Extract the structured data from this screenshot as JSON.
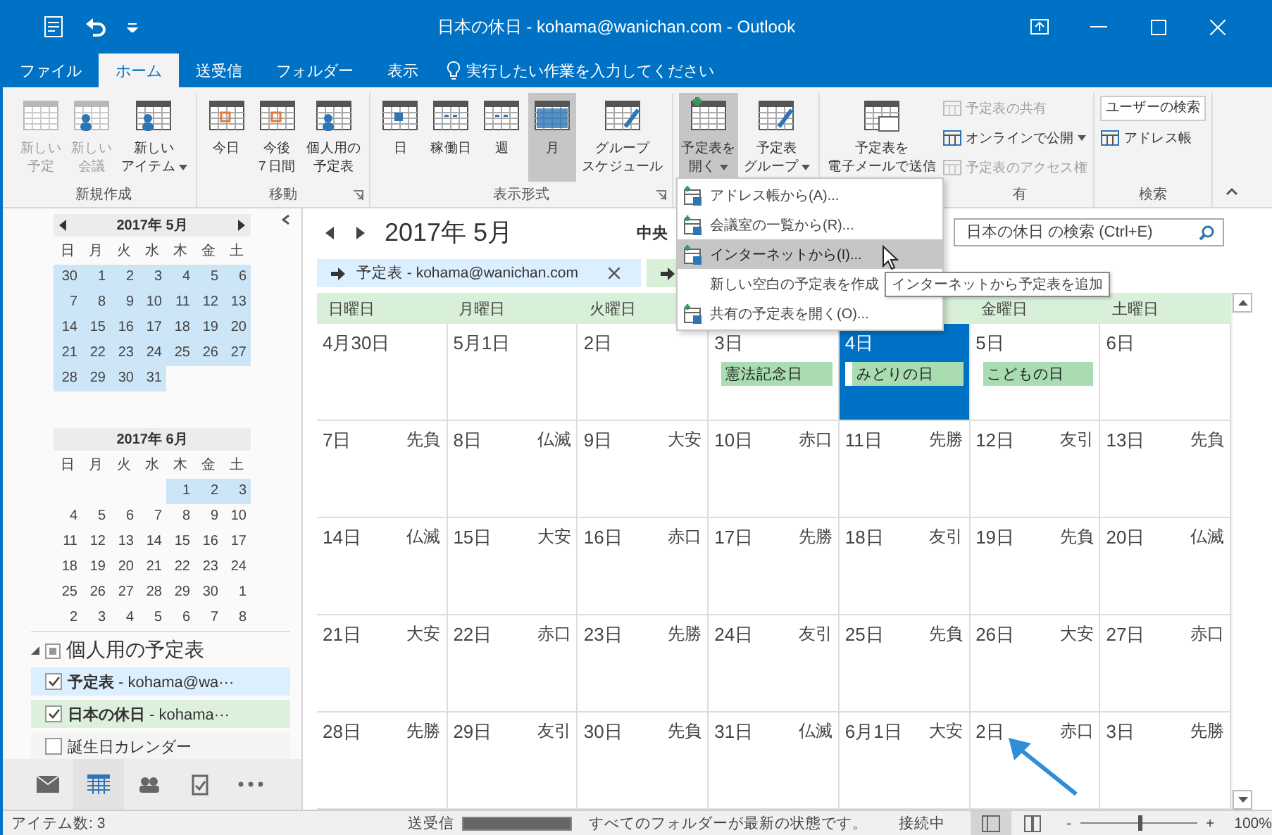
{
  "title_bar": {
    "title": "日本の休日 - kohama@wanichan.com - Outlook"
  },
  "ribbon_tabs": [
    {
      "label": "ファイル",
      "selected": false
    },
    {
      "label": "ホーム",
      "selected": true
    },
    {
      "label": "送受信",
      "selected": false
    },
    {
      "label": "フォルダー",
      "selected": false
    },
    {
      "label": "表示",
      "selected": false
    }
  ],
  "tell_me": "実行したい作業を入力してください",
  "ribbon_groups": [
    {
      "label": "新規作成",
      "launcher": false,
      "buttons": [
        {
          "kind": "large",
          "lines": [
            "新しい",
            "予定"
          ],
          "disabled": true,
          "selected": false,
          "dropdown": false
        },
        {
          "kind": "large",
          "lines": [
            "新しい",
            "会議"
          ],
          "disabled": true,
          "selected": false,
          "dropdown": false
        },
        {
          "kind": "large",
          "lines": [
            "新しい",
            "アイテム"
          ],
          "disabled": false,
          "selected": false,
          "dropdown": true
        }
      ]
    },
    {
      "label": "移動",
      "launcher": true,
      "buttons": [
        {
          "kind": "large",
          "lines": [
            "今日"
          ],
          "disabled": false,
          "selected": false,
          "dropdown": false
        },
        {
          "kind": "large",
          "lines": [
            "今後",
            "7 日間"
          ],
          "disabled": false,
          "selected": false,
          "dropdown": false
        },
        {
          "kind": "large",
          "lines": [
            "個人用の",
            "予定表"
          ],
          "disabled": false,
          "selected": false,
          "dropdown": false
        }
      ]
    },
    {
      "label": "表示形式",
      "launcher": true,
      "buttons": [
        {
          "kind": "large",
          "lines": [
            "日"
          ],
          "disabled": false,
          "selected": false,
          "dropdown": false
        },
        {
          "kind": "large",
          "lines": [
            "稼働日"
          ],
          "disabled": false,
          "selected": false,
          "dropdown": false
        },
        {
          "kind": "large",
          "lines": [
            "週"
          ],
          "disabled": false,
          "selected": false,
          "dropdown": false
        },
        {
          "kind": "large",
          "lines": [
            "月"
          ],
          "disabled": false,
          "selected": true,
          "dropdown": false
        },
        {
          "kind": "large",
          "lines": [
            "グループ",
            "スケジュール"
          ],
          "disabled": false,
          "selected": false,
          "dropdown": false
        }
      ]
    },
    {
      "buttons": [
        {
          "kind": "large",
          "lines": [
            "予定表を",
            "開く"
          ],
          "disabled": false,
          "selected": true,
          "dropdown": true
        },
        {
          "kind": "large",
          "lines": [
            "予定表",
            "グループ"
          ],
          "disabled": false,
          "selected": false,
          "dropdown": true
        }
      ]
    },
    {
      "label": "有",
      "launcher": false,
      "buttons": [
        {
          "kind": "large",
          "lines": [
            "予定表を",
            "電子メールで送信"
          ],
          "disabled": false,
          "selected": false,
          "dropdown": false
        },
        {
          "kind": "small",
          "lines": [
            "予定表の共有"
          ],
          "disabled": true,
          "dropdown": false
        },
        {
          "kind": "small",
          "lines": [
            "オンラインで公開"
          ],
          "disabled": false,
          "dropdown": true
        },
        {
          "kind": "small",
          "lines": [
            "予定表のアクセス権"
          ],
          "disabled": true,
          "dropdown": false
        }
      ]
    },
    {
      "label": "検索",
      "launcher": false,
      "buttons": [
        {
          "kind": "field",
          "lines": [
            "ユーザーの検索"
          ]
        },
        {
          "kind": "small",
          "lines": [
            "アドレス帳"
          ],
          "disabled": false,
          "dropdown": false
        }
      ]
    }
  ],
  "mini_calendars": [
    {
      "title": "2017年 5月",
      "arrows": true,
      "weekdays": [
        "日",
        "月",
        "火",
        "水",
        "木",
        "金",
        "土"
      ],
      "days": [
        {
          "day": "30",
          "highlighted": true
        },
        {
          "day": "1",
          "highlighted": true
        },
        {
          "day": "2",
          "highlighted": true
        },
        {
          "day": "3",
          "highlighted": true
        },
        {
          "day": "4",
          "highlighted": true
        },
        {
          "day": "5",
          "highlighted": true
        },
        {
          "day": "6",
          "highlighted": true
        },
        {
          "day": "7",
          "highlighted": true
        },
        {
          "day": "8",
          "highlighted": true
        },
        {
          "day": "9",
          "highlighted": true
        },
        {
          "day": "10",
          "highlighted": true
        },
        {
          "day": "11",
          "highlighted": true
        },
        {
          "day": "12",
          "highlighted": true
        },
        {
          "day": "13",
          "highlighted": true
        },
        {
          "day": "14",
          "highlighted": true
        },
        {
          "day": "15",
          "highlighted": true
        },
        {
          "day": "16",
          "highlighted": true
        },
        {
          "day": "17",
          "highlighted": true
        },
        {
          "day": "18",
          "highlighted": true
        },
        {
          "day": "19",
          "highlighted": true
        },
        {
          "day": "20",
          "highlighted": true
        },
        {
          "day": "21",
          "highlighted": true
        },
        {
          "day": "22",
          "highlighted": true
        },
        {
          "day": "23",
          "highlighted": true
        },
        {
          "day": "24",
          "highlighted": true
        },
        {
          "day": "25",
          "highlighted": true
        },
        {
          "day": "26",
          "highlighted": true
        },
        {
          "day": "27",
          "highlighted": true
        },
        {
          "day": "28",
          "highlighted": true
        },
        {
          "day": "29",
          "highlighted": true
        },
        {
          "day": "30",
          "highlighted": true
        },
        {
          "day": "31",
          "highlighted": true
        }
      ]
    },
    {
      "title": "2017年 6月",
      "arrows": false,
      "weekdays": [
        "日",
        "月",
        "火",
        "水",
        "木",
        "金",
        "土"
      ],
      "days": [
        {
          "day": "1",
          "highlighted": true
        },
        {
          "day": "2",
          "highlighted": true
        },
        {
          "day": "3",
          "highlighted": true
        },
        {
          "day": "4",
          "highlighted": false
        },
        {
          "day": "5",
          "highlighted": false
        },
        {
          "day": "6",
          "highlighted": false
        },
        {
          "day": "7",
          "highlighted": false
        },
        {
          "day": "8",
          "highlighted": false
        },
        {
          "day": "9",
          "highlighted": false
        },
        {
          "day": "10",
          "highlighted": false
        },
        {
          "day": "11",
          "highlighted": false
        },
        {
          "day": "12",
          "highlighted": false
        },
        {
          "day": "13",
          "highlighted": false
        },
        {
          "day": "14",
          "highlighted": false
        },
        {
          "day": "15",
          "highlighted": false
        },
        {
          "day": "16",
          "highlighted": false
        },
        {
          "day": "17",
          "highlighted": false
        },
        {
          "day": "18",
          "highlighted": false
        },
        {
          "day": "19",
          "highlighted": false
        },
        {
          "day": "20",
          "highlighted": false
        },
        {
          "day": "21",
          "highlighted": false
        },
        {
          "day": "22",
          "highlighted": false
        },
        {
          "day": "23",
          "highlighted": false
        },
        {
          "day": "24",
          "highlighted": false
        },
        {
          "day": "25",
          "highlighted": false
        },
        {
          "day": "26",
          "highlighted": false
        },
        {
          "day": "27",
          "highlighted": false
        },
        {
          "day": "28",
          "highlighted": false
        },
        {
          "day": "29",
          "highlighted": false
        },
        {
          "day": "30",
          "highlighted": false
        },
        {
          "day": "1",
          "highlighted": false
        },
        {
          "day": "2",
          "highlighted": false
        },
        {
          "day": "3",
          "highlighted": false
        },
        {
          "day": "4",
          "highlighted": false
        },
        {
          "day": "5",
          "highlighted": false
        },
        {
          "day": "6",
          "highlighted": false
        },
        {
          "day": "7",
          "highlighted": false
        },
        {
          "day": "8",
          "highlighted": false
        }
      ]
    }
  ],
  "calendar_folders": {
    "label": "個人用の予定表",
    "expanded": true,
    "items": [
      {
        "text": "**予定表** - kohama@wa···",
        "checked": true,
        "color": "#dcefff"
      },
      {
        "text": "**日本の休日** - kohama···",
        "checked": true,
        "color": "#dcf0dc"
      },
      {
        "text": "誕生日カレンダー",
        "checked": false,
        "color": "#f4f4f4"
      }
    ]
  },
  "nav_bar": [
    {
      "selected": false
    },
    {
      "selected": true
    },
    {
      "selected": false
    },
    {
      "selected": false
    },
    {
      "selected": false
    }
  ],
  "calendar": {
    "title": "2017年 5月",
    "location": "中央",
    "search": {
      "placeholder": "日本の休日 の検索 (Ctrl+E)"
    },
    "tabs": [
      {
        "label": "予定表 - kohama@wanichan.com",
        "closable": true,
        "color": "#dcefff"
      },
      {
        "color": "#d8efd8"
      }
    ],
    "weekdays": [
      "日曜日",
      "月曜日",
      "火曜日",
      "金曜日",
      "土曜日"
    ],
    "days": [
      {
        "date": "4月30日",
        "selected": false
      },
      {
        "date": "5月1日",
        "selected": false
      },
      {
        "date": "2日",
        "selected": false
      },
      {
        "date": "3日",
        "event": "憲法記念日",
        "selected": false
      },
      {
        "date": "4日",
        "event": "みどりの日",
        "selected": true
      },
      {
        "date": "5日",
        "event": "こどもの日",
        "selected": false
      },
      {
        "date": "6日",
        "selected": false
      },
      {
        "date": "7日",
        "rokuyo": "先負",
        "selected": false
      },
      {
        "date": "8日",
        "rokuyo": "仏滅",
        "selected": false
      },
      {
        "date": "9日",
        "rokuyo": "大安",
        "selected": false
      },
      {
        "date": "10日",
        "rokuyo": "赤口",
        "selected": false
      },
      {
        "date": "11日",
        "rokuyo": "先勝",
        "selected": false
      },
      {
        "date": "12日",
        "rokuyo": "友引",
        "selected": false
      },
      {
        "date": "13日",
        "rokuyo": "先負",
        "selected": false
      },
      {
        "date": "14日",
        "rokuyo": "仏滅",
        "selected": false
      },
      {
        "date": "15日",
        "rokuyo": "大安",
        "selected": false
      },
      {
        "date": "16日",
        "rokuyo": "赤口",
        "selected": false
      },
      {
        "date": "17日",
        "rokuyo": "先勝",
        "selected": false
      },
      {
        "date": "18日",
        "rokuyo": "友引",
        "selected": false
      },
      {
        "date": "19日",
        "rokuyo": "先負",
        "selected": false
      },
      {
        "date": "20日",
        "rokuyo": "仏滅",
        "selected": false
      },
      {
        "date": "21日",
        "rokuyo": "大安",
        "selected": false
      },
      {
        "date": "22日",
        "rokuyo": "赤口",
        "selected": false
      },
      {
        "date": "23日",
        "rokuyo": "先勝",
        "selected": false
      },
      {
        "date": "24日",
        "rokuyo": "友引",
        "selected": false
      },
      {
        "date": "25日",
        "rokuyo": "先負",
        "selected": false
      },
      {
        "date": "26日",
        "rokuyo": "大安",
        "selected": false
      },
      {
        "date": "27日",
        "rokuyo": "赤口",
        "selected": false
      },
      {
        "date": "28日",
        "rokuyo": "先勝",
        "selected": false
      },
      {
        "date": "29日",
        "rokuyo": "友引",
        "selected": false
      },
      {
        "date": "30日",
        "rokuyo": "先負",
        "selected": false
      },
      {
        "date": "31日",
        "rokuyo": "仏滅",
        "selected": false
      },
      {
        "date": "6月1日",
        "rokuyo": "大安",
        "selected": false
      },
      {
        "date": "2日",
        "rokuyo": "赤口",
        "selected": false
      },
      {
        "date": "3日",
        "rokuyo": "先勝",
        "selected": false
      }
    ]
  },
  "dropdown_menu": {
    "items": [
      {
        "label": "アドレス帳から(A)...",
        "has_icon": true,
        "highlighted": false
      },
      {
        "label": "会議室の一覧から(R)...",
        "has_icon": true,
        "highlighted": false
      },
      {
        "label": "インターネットから(I)...",
        "has_icon": true,
        "highlighted": true
      },
      {
        "label": "新しい空白の予定表を作成",
        "has_icon": false,
        "highlighted": false
      },
      {
        "label": "共有の予定表を開く(O)...",
        "has_icon": true,
        "highlighted": false
      }
    ]
  },
  "tooltip": "インターネットから予定表を追加",
  "status_bar": {
    "items": "アイテム数: 3",
    "sync_label": "送受信",
    "sync_progress": {
      "level": 1
    },
    "status": "すべてのフォルダーが最新の状態です。",
    "connection": "接続中",
    "views": [
      {
        "selected": true
      },
      {
        "selected": false
      }
    ],
    "zoom_minus": "-",
    "zoom": {
      "level": 0.5
    },
    "zoom_plus": "+",
    "zoom_value": "100%"
  }
}
